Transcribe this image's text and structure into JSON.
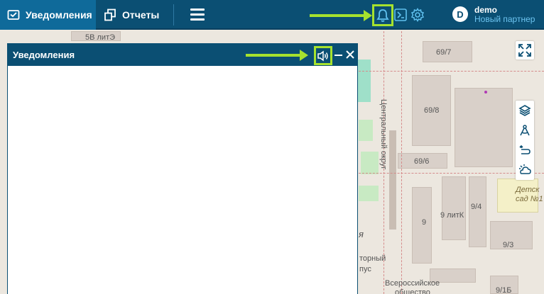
{
  "topbar": {
    "tabs": [
      {
        "label": "Уведомления",
        "icon": "mail-check-icon",
        "active": true
      },
      {
        "label": "Отчеты",
        "icon": "report-pages-icon",
        "active": false
      }
    ],
    "menu_icon": "hamburger-icon",
    "icons": [
      "bell-icon",
      "console-icon",
      "gear-icon"
    ],
    "user": {
      "avatar_letter": "D",
      "name": "demo",
      "role": "Новый партнер"
    }
  },
  "panel": {
    "title": "Уведомления",
    "buttons": [
      "sound-icon",
      "minimize-icon",
      "close-icon"
    ]
  },
  "map": {
    "labels": {
      "l1": "5В литЭ",
      "l2": "69/7",
      "l3": "69/8",
      "l4": "69/6",
      "l5": "Центральный округ",
      "l6": "Детск",
      "l7": "сад №1",
      "l8": "9 литК",
      "l9": "9/4",
      "l10": "9",
      "l11": "9/3",
      "l12": "9/1Б",
      "l13": "торный",
      "l14": "пус",
      "l15": "Всероссийское",
      "l16": "общество",
      "l17": "я"
    },
    "controls": [
      "fullscreen-icon",
      "layers-icon",
      "compass-tool-icon",
      "route-icon",
      "weather-icon"
    ]
  },
  "colors": {
    "header": "#0b4f73",
    "active_tab": "#0f6a9a",
    "highlight": "#a6e22e",
    "user_role": "#6cc4f0"
  }
}
